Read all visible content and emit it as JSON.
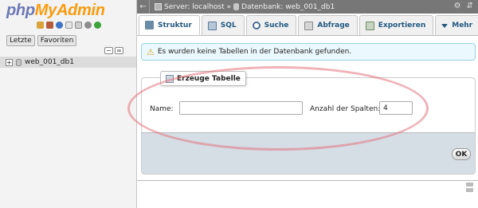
{
  "nav": {
    "logo_php": "php",
    "logo_myadmin": "MyAdmin",
    "tabs": [
      {
        "label": "Letzte"
      },
      {
        "label": "Favoriten"
      }
    ],
    "collapse_symbol": "−",
    "link_symbol": "∞",
    "databases": [
      {
        "expand_symbol": "+",
        "name": "web_001_db1"
      }
    ]
  },
  "topbar": {
    "back_symbol": "←",
    "server_label": "Server: localhost »",
    "database_label": "Datenbank: web_001_db1",
    "settings_symbol": "⚙",
    "collapse_symbol": "⇵"
  },
  "tabs": [
    {
      "label": "Struktur",
      "icon": "structure-icon",
      "active": true
    },
    {
      "label": "SQL",
      "icon": "sql-icon"
    },
    {
      "label": "Suche",
      "icon": "search-icon"
    },
    {
      "label": "Abfrage",
      "icon": "query-icon"
    },
    {
      "label": "Exportieren",
      "icon": "export-icon"
    },
    {
      "label": "Mehr",
      "icon": "chevron-down-icon"
    }
  ],
  "notice": {
    "icon_symbol": "⚠",
    "text": "Es wurden keine Tabellen in der Datenbank gefunden."
  },
  "create_table": {
    "legend": "Erzeuge Tabelle",
    "name_label": "Name:",
    "name_value": "",
    "columns_label": "Anzahl der Spalten:",
    "columns_value": "4",
    "ok_label": "OK"
  },
  "colors": {
    "logo_php": "#6c78b7",
    "logo_myadmin": "#f89c0e",
    "tab_text": "#235a81",
    "notice_bg": "#ebf8fd",
    "form_footer_bg": "#d5dde5",
    "highlight": "#e4737d"
  }
}
